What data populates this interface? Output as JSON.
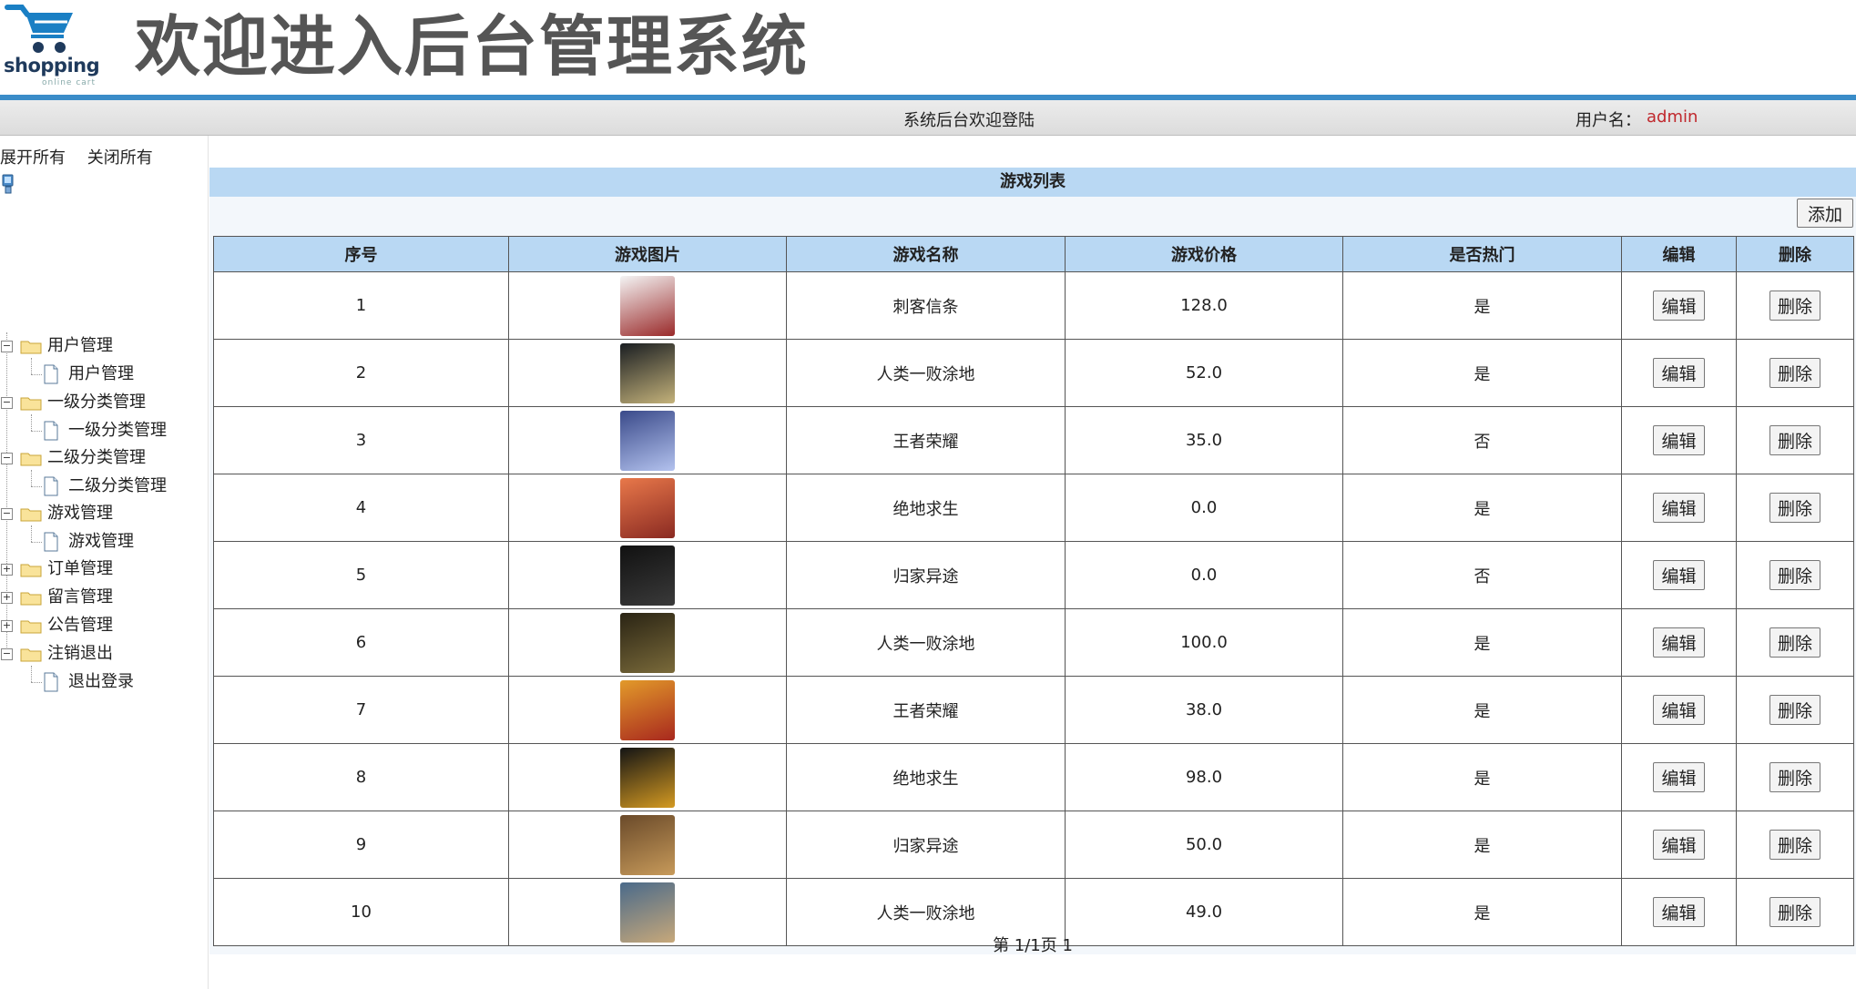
{
  "header": {
    "logo_text": "shopping",
    "logo_sub": "online cart",
    "title": "欢迎进入后台管理系统"
  },
  "statusbar": {
    "welcome": "系统后台欢迎登陆",
    "user_label": "用户名：",
    "user_name": "admin"
  },
  "sidebar": {
    "expand_all": "展开所有",
    "collapse_all": "关闭所有",
    "groups": [
      {
        "label": "用户管理",
        "expanded": true,
        "child": "用户管理"
      },
      {
        "label": "一级分类管理",
        "expanded": true,
        "child": "一级分类管理"
      },
      {
        "label": "二级分类管理",
        "expanded": true,
        "child": "二级分类管理"
      },
      {
        "label": "游戏管理",
        "expanded": true,
        "child": "游戏管理"
      },
      {
        "label": "订单管理",
        "expanded": false
      },
      {
        "label": "留言管理",
        "expanded": false
      },
      {
        "label": "公告管理",
        "expanded": false
      },
      {
        "label": "注销退出",
        "expanded": true,
        "child": "退出登录"
      }
    ]
  },
  "main": {
    "panel_title": "游戏列表",
    "add_label": "添加",
    "columns": [
      "序号",
      "游戏图片",
      "游戏名称",
      "游戏价格",
      "是否热门",
      "编辑",
      "删除"
    ],
    "edit_label": "编辑",
    "delete_label": "删除",
    "rows": [
      {
        "no": "1",
        "name": "刺客信条",
        "price": "128.0",
        "hot": "是",
        "thumb_colors": [
          "#f4f4f4",
          "#9a2a2a"
        ]
      },
      {
        "no": "2",
        "name": "人类一败涂地",
        "price": "52.0",
        "hot": "是",
        "thumb_colors": [
          "#1a1e22",
          "#c4b27a"
        ]
      },
      {
        "no": "3",
        "name": "王者荣耀",
        "price": "35.0",
        "hot": "否",
        "thumb_colors": [
          "#3a4a8a",
          "#b3c2ee"
        ]
      },
      {
        "no": "4",
        "name": "绝地求生",
        "price": "0.0",
        "hot": "是",
        "thumb_colors": [
          "#e8784a",
          "#8a2a22"
        ]
      },
      {
        "no": "5",
        "name": "归家异途",
        "price": "0.0",
        "hot": "否",
        "thumb_colors": [
          "#111111",
          "#3a3a3a"
        ]
      },
      {
        "no": "6",
        "name": "人类一败涂地",
        "price": "100.0",
        "hot": "是",
        "thumb_colors": [
          "#2a2414",
          "#7a6a3a"
        ]
      },
      {
        "no": "7",
        "name": "王者荣耀",
        "price": "38.0",
        "hot": "是",
        "thumb_colors": [
          "#e29a2a",
          "#a8281e"
        ]
      },
      {
        "no": "8",
        "name": "绝地求生",
        "price": "98.0",
        "hot": "是",
        "thumb_colors": [
          "#141414",
          "#d49a22"
        ]
      },
      {
        "no": "9",
        "name": "归家异途",
        "price": "50.0",
        "hot": "是",
        "thumb_colors": [
          "#6a4a2a",
          "#c79a5a"
        ]
      },
      {
        "no": "10",
        "name": "人类一败涂地",
        "price": "49.0",
        "hot": "是",
        "thumb_colors": [
          "#4a6a8a",
          "#c7a87a"
        ]
      }
    ],
    "pager": "第 1/1页 1"
  },
  "colors": {
    "header_rule": "#3a8cc8",
    "panel_header": "#b9d8f3",
    "user_name": "#c0282d"
  },
  "icons": {
    "logo": "shopping-cart-icon",
    "root": "computer-icon",
    "group": "folder-icon",
    "leaf": "document-icon"
  }
}
